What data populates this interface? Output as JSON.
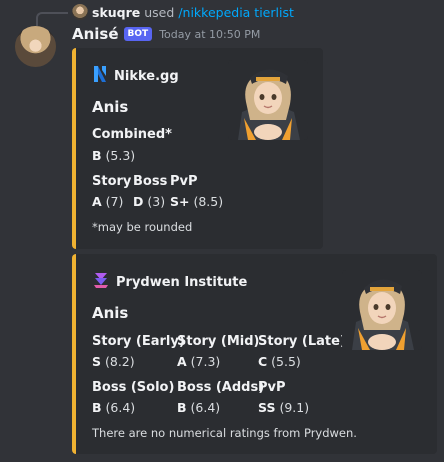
{
  "reply": {
    "username": "skuqre",
    "used_text": "used",
    "command": "/nikkepedia tierlist"
  },
  "message": {
    "author": "Anisé",
    "bot_tag": "BOT",
    "timestamp": "Today at 10:50 PM"
  },
  "embeds": [
    {
      "provider": "Nikke.gg",
      "provider_icon": "nikke-gg-logo-icon",
      "title": "Anis",
      "accent_color": "#f0b232",
      "combined": {
        "label": "Combined*",
        "grade": "B",
        "score": "(5.3)"
      },
      "fields": [
        {
          "name": "Story",
          "grade": "A",
          "score": "(7)"
        },
        {
          "name": "Boss",
          "grade": "D",
          "score": "(3)"
        },
        {
          "name": "PvP",
          "grade": "S+",
          "score": "(8.5)"
        }
      ],
      "footnote": "*may be rounded"
    },
    {
      "provider": "Prydwen Institute",
      "provider_icon": "prydwen-logo-icon",
      "title": "Anis",
      "accent_color": "#f0b232",
      "fields": [
        {
          "name": "Story (Early)",
          "grade": "S",
          "score": "(8.2)"
        },
        {
          "name": "Story (Mid)",
          "grade": "A",
          "score": "(7.3)"
        },
        {
          "name": "Story (Late)",
          "grade": "C",
          "score": "(5.5)"
        },
        {
          "name": "Boss (Solo)",
          "grade": "B",
          "score": "(6.4)"
        },
        {
          "name": "Boss (Adds)",
          "grade": "B",
          "score": "(6.4)"
        },
        {
          "name": "PvP",
          "grade": "SS",
          "score": "(9.1)"
        }
      ],
      "footnote": "There are no numerical ratings from Prydwen."
    }
  ]
}
